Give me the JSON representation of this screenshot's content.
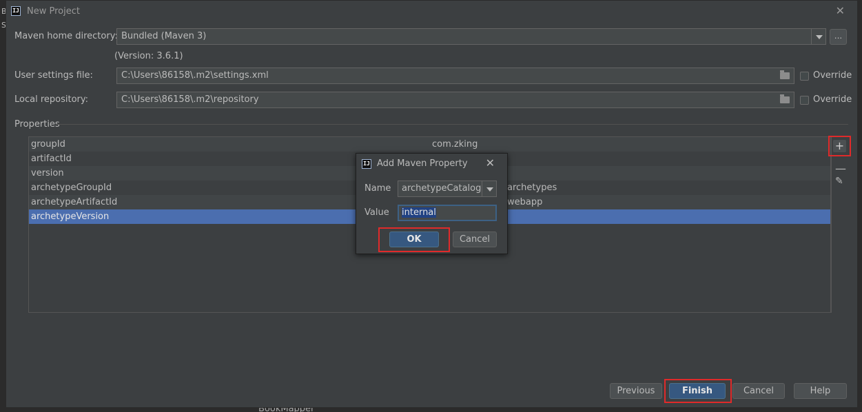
{
  "window": {
    "title": "New Project"
  },
  "maven": {
    "home_label": "Maven home directory:",
    "home_value": "Bundled (Maven 3)",
    "version_text": "(Version: 3.6.1)",
    "dots_label": "...",
    "settings_label": "User settings file:",
    "settings_value": "C:\\Users\\86158\\.m2\\settings.xml",
    "repo_label": "Local repository:",
    "repo_value": "C:\\Users\\86158\\.m2\\repository",
    "override_label": "Override"
  },
  "properties": {
    "heading": "Properties",
    "rows": [
      {
        "key": "groupId",
        "value": "com.zking"
      },
      {
        "key": "artifactId",
        "value": ""
      },
      {
        "key": "version",
        "value": ""
      },
      {
        "key": "archetypeGroupId",
        "value": "archetypes"
      },
      {
        "key": "archetypeArtifactId",
        "value": "webapp"
      },
      {
        "key": "archetypeVersion",
        "value": ""
      }
    ]
  },
  "dialog": {
    "title": "Add Maven Property",
    "name_label": "Name",
    "name_value": "archetypeCatalog",
    "value_label": "Value",
    "value_value": "internal",
    "ok_label": "OK",
    "cancel_label": "Cancel"
  },
  "footer": {
    "previous_label": "Previous",
    "finish_label": "Finish",
    "cancel_label": "Cancel",
    "help_label": "Help"
  },
  "background": {
    "bottom_text": "BookMapper"
  }
}
